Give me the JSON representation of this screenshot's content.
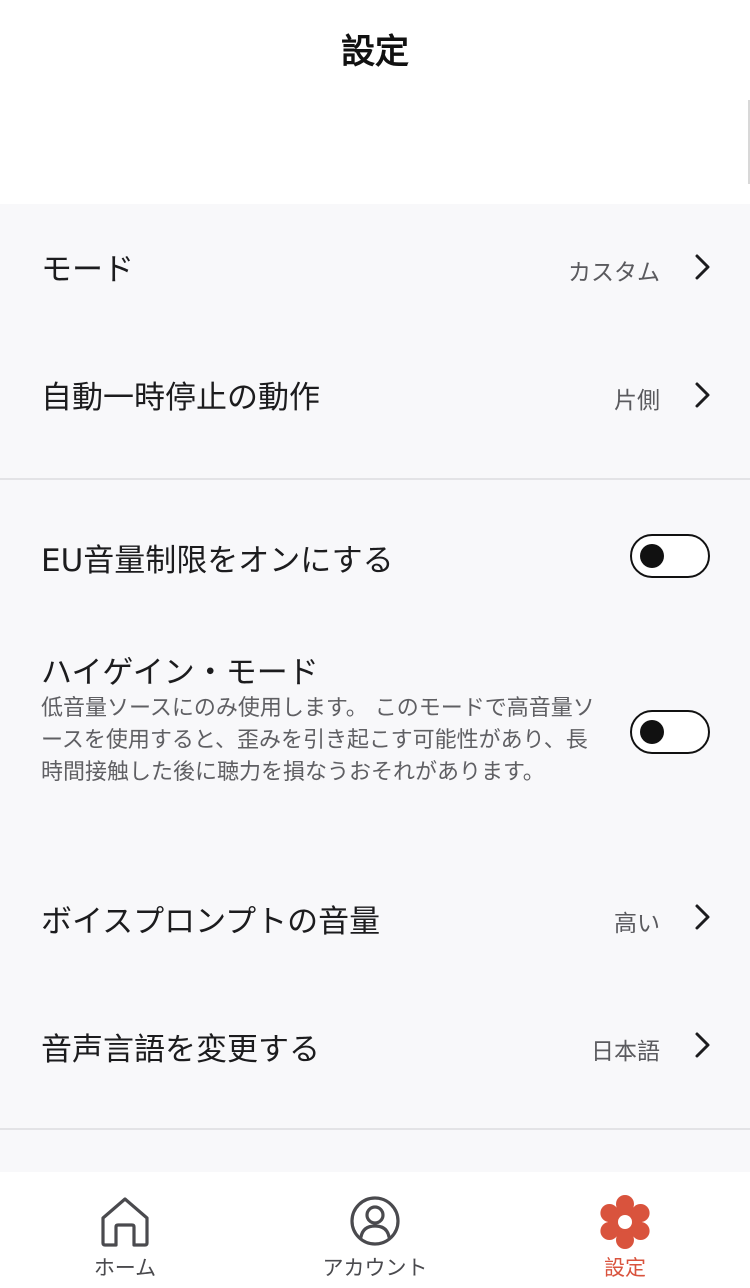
{
  "header": {
    "title": "設定"
  },
  "settings": {
    "mode": {
      "label": "モード",
      "value": "カスタム"
    },
    "auto_pause": {
      "label": "自動一時停止の動作",
      "value": "片側"
    },
    "eu_volume": {
      "label": "EU音量制限をオンにする",
      "enabled": false
    },
    "high_gain": {
      "label": "ハイゲイン・モード",
      "description": "低音量ソースにのみ使用します。 このモードで高音量ソースを使用すると、歪みを引き起こす可能性があり、長時間接触した後に聴力を損なうおそれがあります。",
      "enabled": false
    },
    "voice_prompt_volume": {
      "label": "ボイスプロンプトの音量",
      "value": "高い"
    },
    "voice_language": {
      "label": "音声言語を変更する",
      "value": "日本語"
    }
  },
  "tabbar": {
    "tabs": [
      {
        "label": "ホーム",
        "icon": "home-icon",
        "active": false
      },
      {
        "label": "アカウント",
        "icon": "account-icon",
        "active": false
      },
      {
        "label": "設定",
        "icon": "gear-icon",
        "active": true
      }
    ]
  },
  "colors": {
    "accent": "#d9533d",
    "background": "#f8f8fa",
    "text": "#1c1c1e",
    "secondary_text": "#5a5a5e"
  }
}
